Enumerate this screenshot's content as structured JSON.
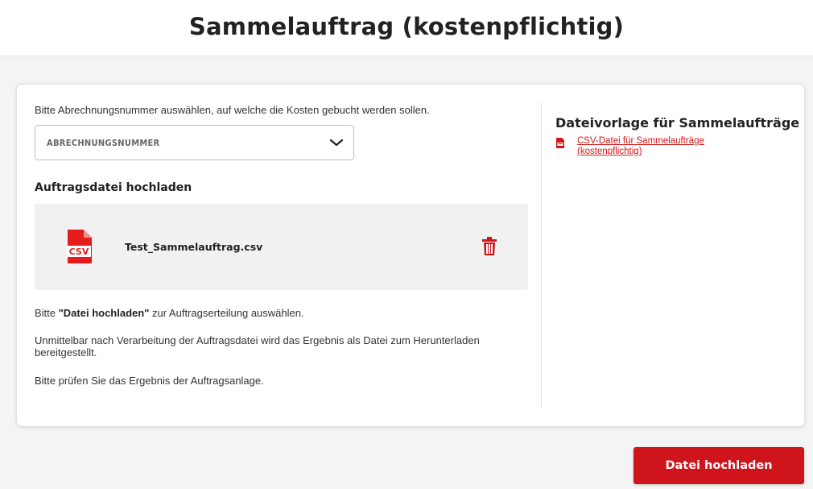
{
  "page": {
    "title": "Sammelauftrag (kostenpflichtig)"
  },
  "form": {
    "prompt": "Bitte Abrechnungsnummer auswählen, auf welche die Kosten gebucht werden sollen.",
    "select": {
      "value": "ABRECHNUNGSNUMMER",
      "icon": "chevron-down-icon"
    },
    "upload_heading": "Auftragsdatei hochladen",
    "file": {
      "name": "Test_Sammelauftrag.csv",
      "icon": "csv-file-icon",
      "delete_icon": "trash-icon"
    },
    "note1_prefix": "Bitte ",
    "note1_bold": "\"Datei hochladen\"",
    "note1_suffix": " zur Auftragserteilung auswählen.",
    "note2": "Unmittelbar nach Verarbeitung der Auftragsdatei wird das Ergebnis als Datei zum Herunterladen bereitgestellt.",
    "note3": "Bitte prüfen Sie das Ergebnis der Auftragsanlage."
  },
  "sidebar": {
    "heading": "Dateivorlage für Sammelaufträge",
    "link_text": "CSV-Datei für Sammelaufträge (kostenpflichtig)",
    "link_icon": "csv-file-icon"
  },
  "actions": {
    "upload_label": "Datei hochladen"
  },
  "colors": {
    "accent": "#d0141c",
    "link": "#d01818",
    "background": "#f4f4f4"
  }
}
